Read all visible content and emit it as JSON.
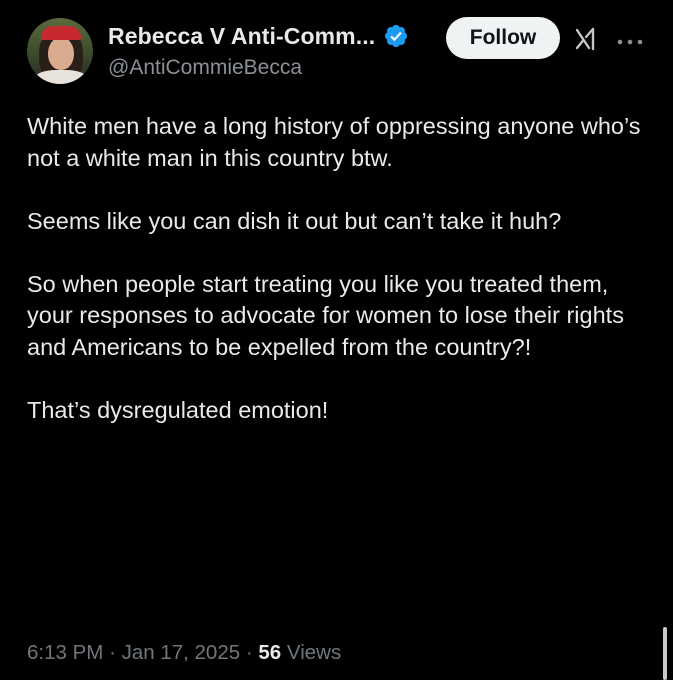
{
  "author": {
    "display_name": "Rebecca V Anti-Comm...",
    "handle": "@AntiCommieBecca",
    "verified": true
  },
  "actions": {
    "follow_label": "Follow"
  },
  "icons": {
    "verified": "verified-badge-icon",
    "grok": "grok-icon",
    "more": "more-options-icon"
  },
  "tweet": {
    "paragraphs": [
      "White men have a long history of oppressing anyone who’s not a white man in this country btw.",
      "Seems like you can dish it out but can’t take it huh?",
      "So when people start treating you like you treated them, your responses to advocate for women to lose their rights and Americans to be expelled from the country?!",
      "That’s dysregulated emotion!"
    ],
    "time": "6:13 PM",
    "date": "Jan 17, 2025",
    "separator": "·",
    "views_count": "56",
    "views_label": "Views"
  },
  "colors": {
    "background": "#000000",
    "text_primary": "#e7e9ea",
    "text_secondary": "#71767b",
    "verified_blue": "#1d9bf0",
    "follow_bg": "#eff3f4"
  }
}
